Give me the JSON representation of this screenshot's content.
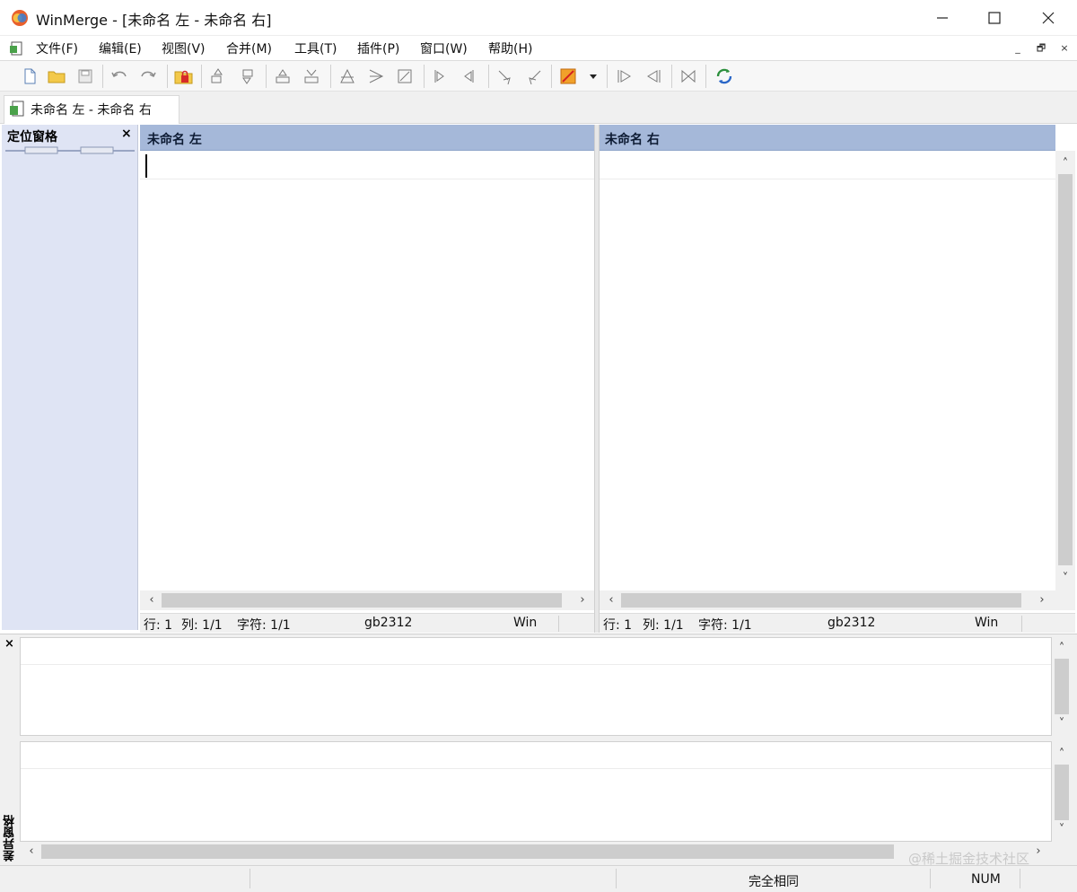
{
  "window": {
    "title": "WinMerge - [未命名 左 - 未命名 右]",
    "controls": {
      "minimize": "minimize-icon",
      "maximize": "maximize-icon",
      "close": "close-icon"
    }
  },
  "menu": {
    "items": [
      "文件(F)",
      "编辑(E)",
      "视图(V)",
      "合并(M)",
      "工具(T)",
      "插件(P)",
      "窗口(W)",
      "帮助(H)"
    ],
    "mdi_controls": [
      "_",
      "🗗",
      "×"
    ]
  },
  "toolbar": {
    "icons": [
      "new-file-icon",
      "open-folder-icon",
      "save-icon",
      "undo-icon",
      "redo-icon",
      "locked-folder-icon",
      "next-diff-icon",
      "prev-diff-icon",
      "first-diff-icon",
      "last-diff-icon",
      "current-diff-icon",
      "merge-down-icon",
      "merge-up-icon",
      "merge-all-icon",
      "copy-right-icon",
      "copy-left-icon",
      "copy-right-advance-icon",
      "copy-left-advance-icon",
      "options-icon",
      "dropdown-arrow-icon",
      "right-to-left-icon",
      "left-to-right-icon",
      "compare-icon",
      "refresh-icon"
    ]
  },
  "tab": {
    "label": "未命名 左 - 未命名 右"
  },
  "location_pane": {
    "title": "定位窗格",
    "close": "×"
  },
  "left_pane": {
    "header": "未命名 左",
    "status": {
      "line": "行: 1",
      "col": "列: 1/1",
      "chars": "字符: 1/1",
      "encoding": "gb2312",
      "eol": "Win"
    }
  },
  "right_pane": {
    "header": "未命名 右",
    "status": {
      "line": "行: 1",
      "col": "列: 1/1",
      "chars": "字符: 1/1",
      "encoding": "gb2312",
      "eol": "Win"
    }
  },
  "diff_pane": {
    "title": "差异窗格",
    "close": "×"
  },
  "statusbar": {
    "state": "完全相同",
    "num": "NUM"
  },
  "watermark": "@稀土掘金技术社区",
  "colors": {
    "pane_header": "#a5b8d9",
    "location_pane": "#dfe4f4"
  }
}
